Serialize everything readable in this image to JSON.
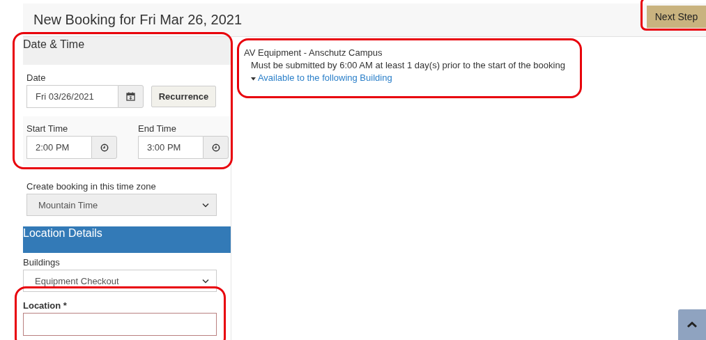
{
  "header": {
    "title": "New Booking for Fri Mar 26, 2021",
    "next_button": "Next Step"
  },
  "date_time": {
    "heading": "Date & Time",
    "date_label": "Date",
    "date_value": "Fri 03/26/2021",
    "recurrence_button": "Recurrence",
    "start_label": "Start Time",
    "start_value": "2:00 PM",
    "end_label": "End Time",
    "end_value": "3:00 PM",
    "timezone_label": "Create booking in this time zone",
    "timezone_value": "Mountain Time"
  },
  "location": {
    "heading": "Location Details",
    "buildings_label": "Buildings",
    "buildings_value": "Equipment Checkout",
    "location_label": "Location *"
  },
  "info": {
    "title": "AV Equipment - Anschutz Campus",
    "rule": "Must be submitted by 6:00 AM at least 1 day(s) prior to the start of the booking",
    "link": "Available to the following Building"
  }
}
